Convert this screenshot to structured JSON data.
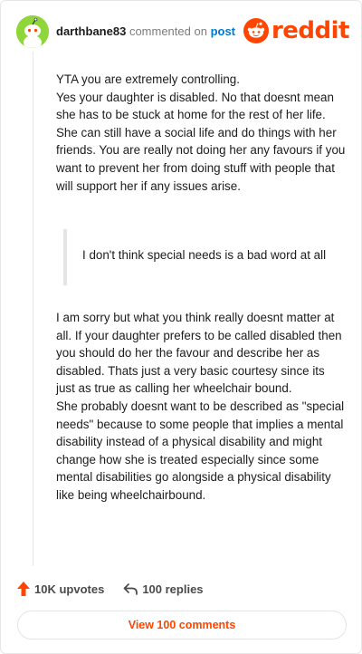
{
  "brand": {
    "word": "reddit",
    "icon": "reddit-snoo-icon",
    "color": "#ff4500"
  },
  "comment": {
    "author": "darthbane83",
    "action": "commented on",
    "post_link": "post",
    "avatar": "snoo-avatar-icon",
    "paragraph_1": [
      "YTA you are extremely controlling.",
      "Yes your daughter is disabled. No that doesnt mean she has to be stuck at home for the rest of her life. She can still have a social life and do things with her friends. You are really not doing her any favours if you want to prevent her from doing stuff with people that will support her if any issues arise."
    ],
    "quote": "I don't think special needs is a bad word at all",
    "paragraph_2": [
      "I am sorry but what you think really doesnt matter at all. If your daughter prefers to be called disabled then you should do her the favour and describe her as disabled. Thats just a very basic courtesy since its just as true as calling her wheelchair bound.",
      "She probably doesnt want to be described as \"special needs\" because to some people that implies a mental disability instead of a physical disability and might change how she is treated especially since some mental disabilities go alongside a physical disability like being wheelchairbound."
    ]
  },
  "actions": {
    "upvotes": "10K upvotes",
    "replies": "100 replies",
    "upvote_icon": "upvote-arrow-icon",
    "reply_icon": "reply-arrow-icon",
    "upvote_color": "#ff4500"
  },
  "view_comments": "View 100 comments",
  "colors": {
    "link": "#0079d3",
    "muted": "#7c7c7c",
    "avatar_bg": "#8fd63a"
  }
}
